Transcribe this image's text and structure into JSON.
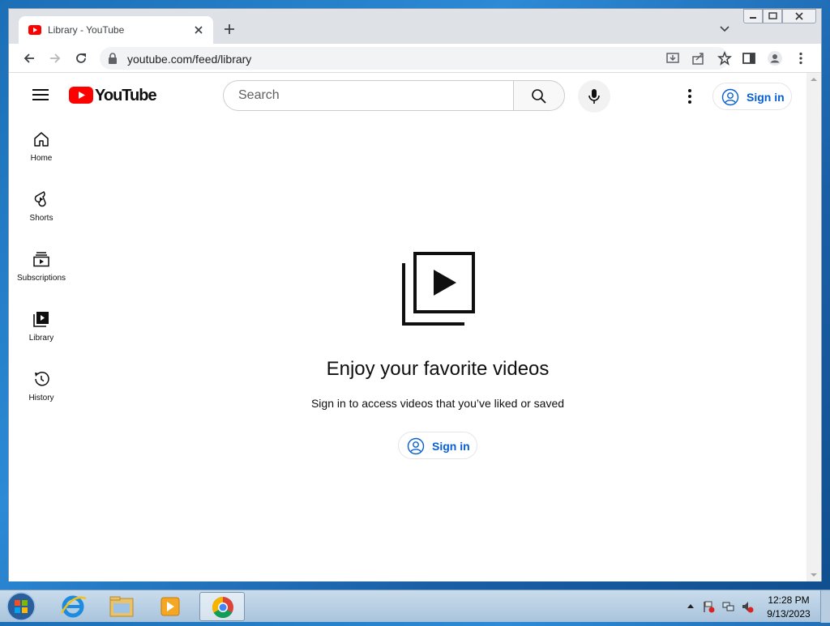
{
  "browser": {
    "tab_title": "Library - YouTube",
    "url": "youtube.com/feed/library"
  },
  "youtube": {
    "logo_text": "YouTube",
    "search_placeholder": "Search",
    "signin_label": "Sign in",
    "sidebar": [
      {
        "label": "Home",
        "icon": "home-icon"
      },
      {
        "label": "Shorts",
        "icon": "shorts-icon"
      },
      {
        "label": "Subscriptions",
        "icon": "subscriptions-icon"
      },
      {
        "label": "Library",
        "icon": "library-icon"
      },
      {
        "label": "History",
        "icon": "history-icon"
      }
    ],
    "empty_state": {
      "title": "Enjoy your favorite videos",
      "subtitle": "Sign in to access videos that you’ve liked or saved",
      "button_label": "Sign in"
    },
    "brand_red": "#ff0000",
    "link_blue": "#065fd4"
  },
  "taskbar": {
    "time": "12:28 PM",
    "date": "9/13/2023"
  }
}
